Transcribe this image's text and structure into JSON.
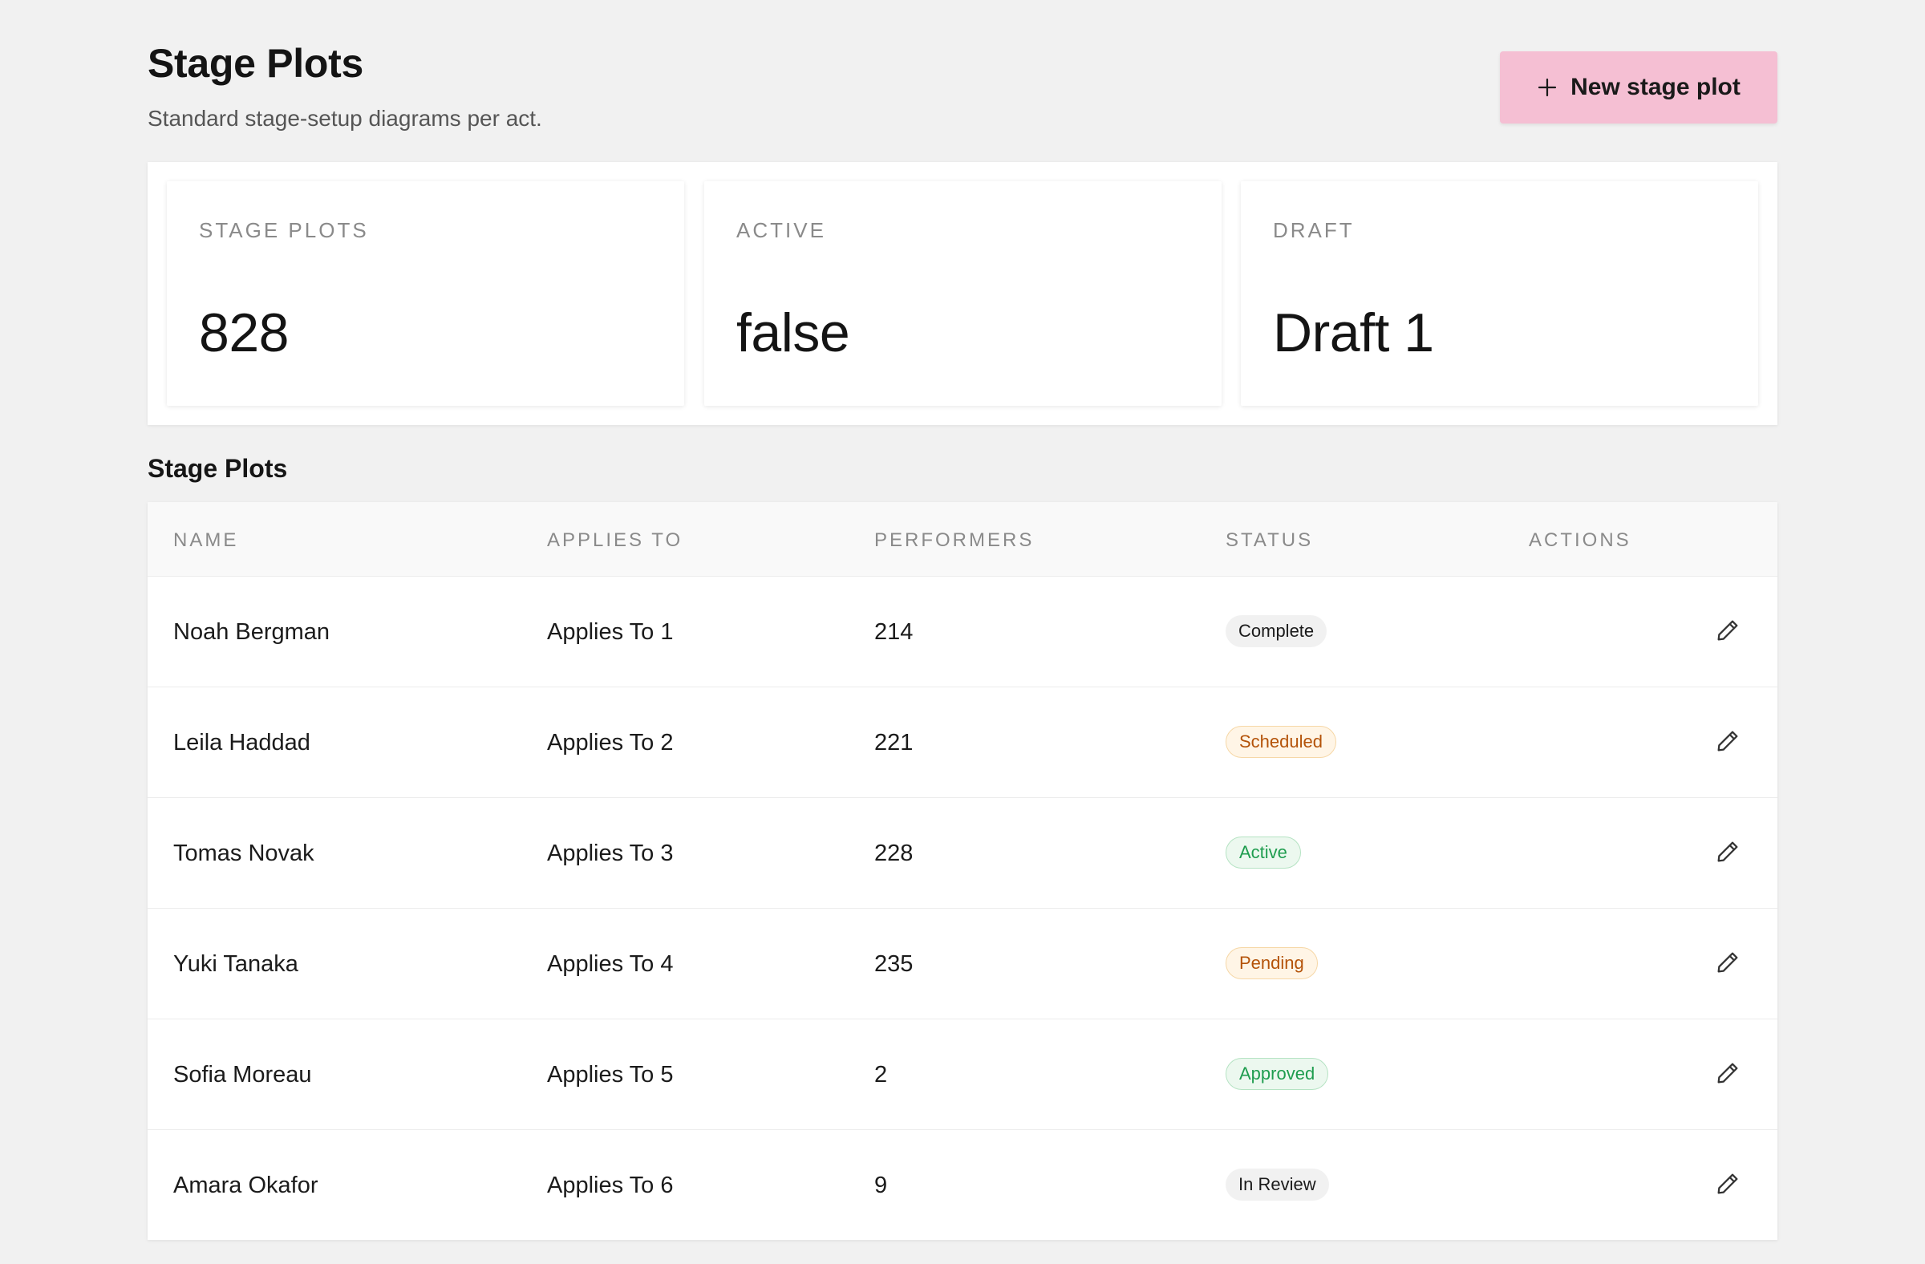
{
  "header": {
    "title": "Stage Plots",
    "subtitle": "Standard stage-setup diagrams per act.",
    "new_button_label": "New stage plot"
  },
  "stats": [
    {
      "label": "STAGE PLOTS",
      "value": "828"
    },
    {
      "label": "ACTIVE",
      "value": "false"
    },
    {
      "label": "DRAFT",
      "value": "Draft 1"
    }
  ],
  "table": {
    "title": "Stage Plots",
    "columns": [
      "NAME",
      "APPLIES TO",
      "PERFORMERS",
      "STATUS",
      "ACTIONS"
    ],
    "rows": [
      {
        "name": "Noah Bergman",
        "applies_to": "Applies To 1",
        "performers": "214",
        "status": "Complete"
      },
      {
        "name": "Leila Haddad",
        "applies_to": "Applies To 2",
        "performers": "221",
        "status": "Scheduled"
      },
      {
        "name": "Tomas Novak",
        "applies_to": "Applies To 3",
        "performers": "228",
        "status": "Active"
      },
      {
        "name": "Yuki Tanaka",
        "applies_to": "Applies To 4",
        "performers": "235",
        "status": "Pending"
      },
      {
        "name": "Sofia Moreau",
        "applies_to": "Applies To 5",
        "performers": "2",
        "status": "Approved"
      },
      {
        "name": "Amara Okafor",
        "applies_to": "Applies To 6",
        "performers": "9",
        "status": "In Review"
      }
    ]
  },
  "colors": {
    "accent_button": "#f5bfd3",
    "status_orange": "#b45309",
    "status_green": "#1f9d4f"
  },
  "icons": {
    "new_button": "plus-icon",
    "row_action": "pencil-icon"
  }
}
